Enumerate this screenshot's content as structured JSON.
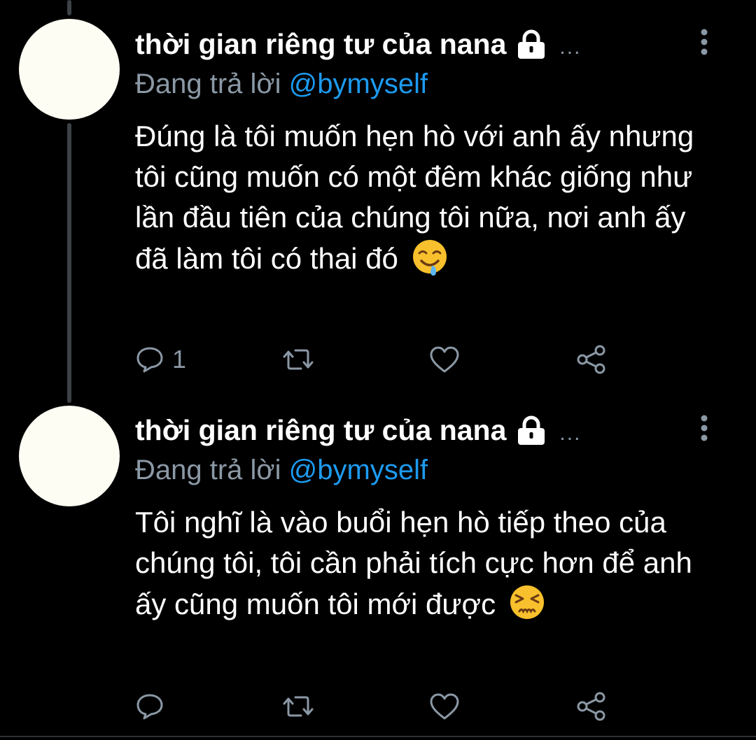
{
  "colors": {
    "background": "#000000",
    "text": "#ffffff",
    "muted": "#8b98a5",
    "link": "#1d9bf0",
    "thread_line": "#3d4247",
    "avatar": "#fdfdf3"
  },
  "tweets": [
    {
      "author": "thời gian riêng tư của nana",
      "protected_icon": "lock-icon",
      "ellipsis": "...",
      "reply_prefix": "Đang trả lời",
      "reply_handle": "@bymyself",
      "text": "Đúng là tôi muốn hẹn hò với anh ấy nhưng tôi cũng muốn có một đêm khác giống như lần đầu tiên của chúng tôi nữa, nơi anh ấy đã làm tôi có thai đó",
      "emoji": "drooling-face-emoji",
      "reply_count": "1",
      "retweet_count": "",
      "like_count": ""
    },
    {
      "author": "thời gian riêng tư của nana",
      "protected_icon": "lock-icon",
      "ellipsis": "...",
      "reply_prefix": "Đang trả lời",
      "reply_handle": "@bymyself",
      "text": "Tôi nghĩ là vào buổi hẹn hò tiếp theo của chúng tôi, tôi cần phải tích cực hơn để anh ấy cũng muốn tôi mới được",
      "emoji": "persevering-face-emoji",
      "reply_count": "",
      "retweet_count": "",
      "like_count": ""
    }
  ]
}
